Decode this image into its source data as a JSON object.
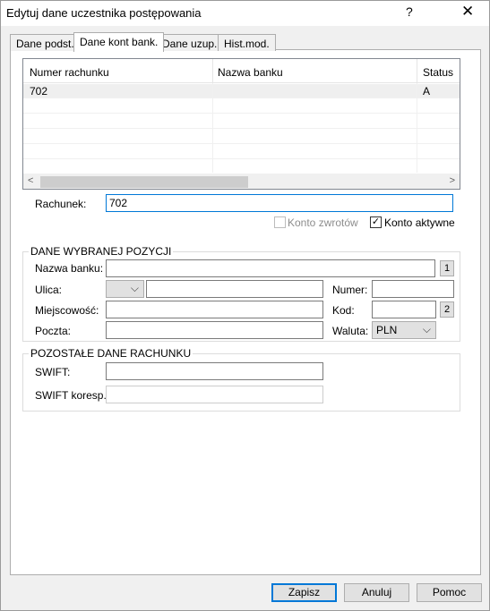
{
  "window": {
    "title": "Edytuj dane uczestnika postępowania",
    "help": "?",
    "close": "✕"
  },
  "tabs": [
    {
      "label": "Dane podst."
    },
    {
      "label": "Dane kont bank."
    },
    {
      "label": "Dane uzup."
    },
    {
      "label": "Hist.mod."
    }
  ],
  "grid": {
    "columns": [
      "Numer rachunku",
      "Nazwa banku",
      "Status"
    ],
    "rows": [
      {
        "numer": "702",
        "bank": "",
        "status": "A"
      }
    ],
    "scroll_left": "<",
    "scroll_right": ">"
  },
  "account": {
    "label": "Rachunek:",
    "value": "702"
  },
  "checkboxes": {
    "konto_zwrotow": {
      "label": "Konto zwrotów",
      "checked": false
    },
    "konto_aktywne": {
      "label": "Konto aktywne",
      "checked": true,
      "mark": "✓"
    }
  },
  "selected_position": {
    "legend": "DANE WYBRANEJ POZYCJI",
    "bank_name_label": "Nazwa banku:",
    "bank_name_value": "",
    "button1": "1",
    "street_label": "Ulica:",
    "street_prefix": "",
    "street_value": "",
    "number_label": "Numer:",
    "number_value": "",
    "city_label": "Miejscowość:",
    "city_value": "",
    "code_label": "Kod:",
    "code_value": "",
    "button2": "2",
    "post_label": "Poczta:",
    "post_value": "",
    "currency_label": "Waluta:",
    "currency_value": "PLN"
  },
  "other_account": {
    "legend": "POZOSTAŁE DANE RACHUNKU",
    "swift_label": "SWIFT:",
    "swift_value": "",
    "swift_koresp_label": "SWIFT koresp.:",
    "swift_koresp_value": ""
  },
  "buttons": {
    "save": "Zapisz",
    "cancel": "Anuluj",
    "help": "Pomoc"
  }
}
